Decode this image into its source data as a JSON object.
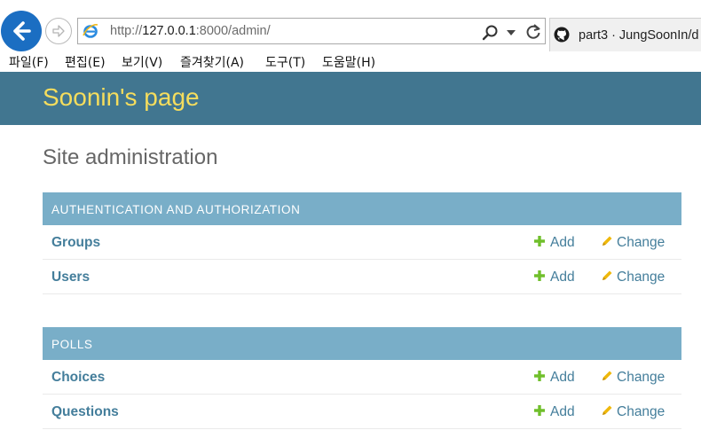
{
  "browser": {
    "url_prefix": "http://",
    "url_host": "127.0.0.1",
    "url_rest": ":8000/admin/",
    "tab_title": "part3 · JungSoonIn/d",
    "menu": [
      "파일(F)",
      "편집(E)",
      "보기(V)",
      "즐겨찾기(A)",
      "도구(T)",
      "도움말(H)"
    ]
  },
  "site": {
    "brand": "Soonin's page",
    "title": "Site administration"
  },
  "modules": [
    {
      "caption": "AUTHENTICATION AND AUTHORIZATION",
      "models": [
        {
          "name": "Groups",
          "add": "Add",
          "change": "Change"
        },
        {
          "name": "Users",
          "add": "Add",
          "change": "Change"
        }
      ]
    },
    {
      "caption": "POLLS",
      "models": [
        {
          "name": "Choices",
          "add": "Add",
          "change": "Change"
        },
        {
          "name": "Questions",
          "add": "Add",
          "change": "Change"
        }
      ]
    }
  ],
  "colors": {
    "header_bg": "#417690",
    "brand_text": "#f5dd5d",
    "module_head_bg": "#79aec8",
    "link": "#447e9b",
    "add_icon": "#70bf2b",
    "change_icon": "#efb80b"
  }
}
